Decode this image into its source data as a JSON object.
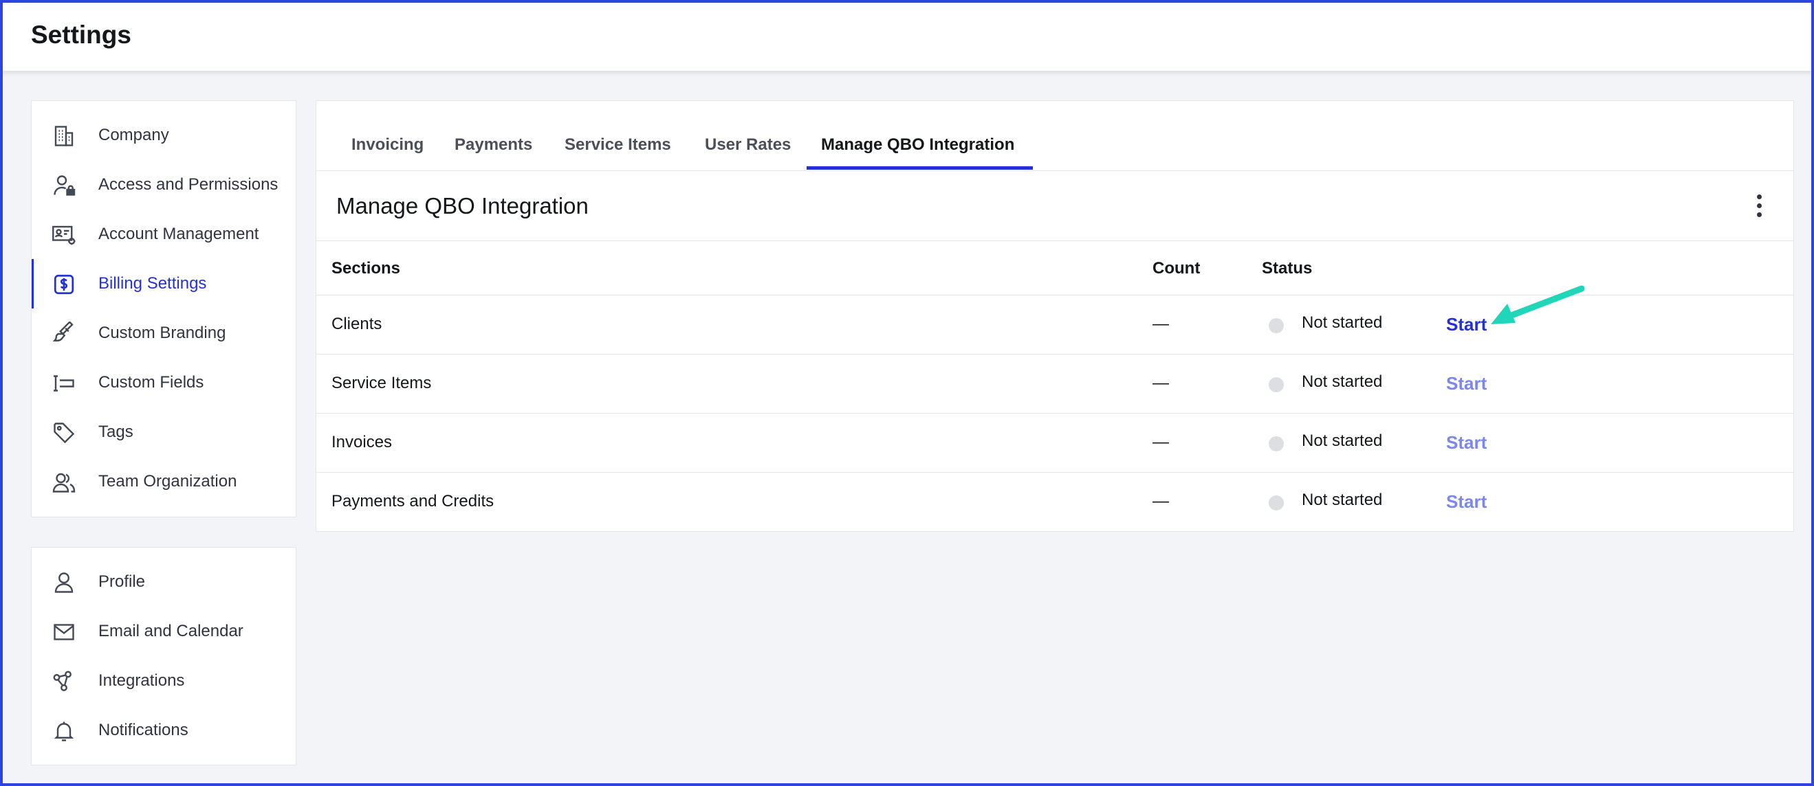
{
  "app": {
    "title": "Settings"
  },
  "sidebar": {
    "primary": [
      {
        "label": "Company",
        "icon": "building-icon"
      },
      {
        "label": "Access and Permissions",
        "icon": "user-lock-icon"
      },
      {
        "label": "Account Management",
        "icon": "id-card-gear-icon"
      },
      {
        "label": "Billing Settings",
        "icon": "dollar-badge-icon",
        "active": true
      },
      {
        "label": "Custom Branding",
        "icon": "paintbrush-icon"
      },
      {
        "label": "Custom Fields",
        "icon": "text-field-icon"
      },
      {
        "label": "Tags",
        "icon": "tag-icon"
      },
      {
        "label": "Team Organization",
        "icon": "users-icon"
      }
    ],
    "secondary": [
      {
        "label": "Profile",
        "icon": "user-icon"
      },
      {
        "label": "Email and Calendar",
        "icon": "envelope-icon"
      },
      {
        "label": "Integrations",
        "icon": "share-nodes-icon"
      },
      {
        "label": "Notifications",
        "icon": "bell-icon"
      }
    ]
  },
  "tabs": [
    {
      "label": "Invoicing"
    },
    {
      "label": "Payments"
    },
    {
      "label": "Service Items"
    },
    {
      "label": "User Rates"
    },
    {
      "label": "Manage QBO Integration",
      "active": true
    }
  ],
  "section": {
    "title": "Manage QBO Integration",
    "menu_icon": "kebab-menu-icon"
  },
  "table": {
    "headers": {
      "sections": "Sections",
      "count": "Count",
      "status": "Status"
    },
    "rows": [
      {
        "section": "Clients",
        "count": "—",
        "status": "Not started",
        "action": "Start"
      },
      {
        "section": "Service Items",
        "count": "—",
        "status": "Not started",
        "action": "Start"
      },
      {
        "section": "Invoices",
        "count": "—",
        "status": "Not started",
        "action": "Start"
      },
      {
        "section": "Payments and Credits",
        "count": "—",
        "status": "Not started",
        "action": "Start"
      }
    ]
  },
  "colors": {
    "accent": "#2332d6",
    "accent_light": "#7c86f0",
    "annotation_arrow": "#1fd6b8",
    "frame": "#2d44e0"
  }
}
